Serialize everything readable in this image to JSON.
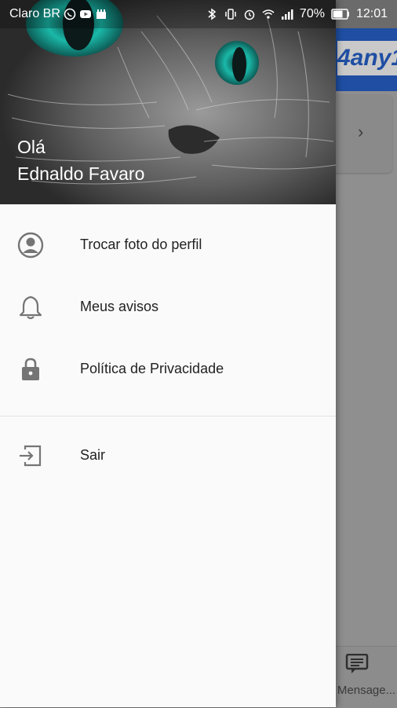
{
  "status_bar": {
    "carrier": "Claro BR",
    "battery": "70%",
    "time": "12:01"
  },
  "background_app": {
    "logo_text": "4any1",
    "bottom_tab_label": "Mensage..."
  },
  "drawer": {
    "greeting": "Olá",
    "user_name": "Ednaldo Favaro",
    "menu": [
      {
        "label": "Trocar foto do perfil",
        "icon": "profile-icon"
      },
      {
        "label": "Meus avisos",
        "icon": "bell-icon"
      },
      {
        "label": "Política de Privacidade",
        "icon": "lock-icon"
      },
      {
        "label": "Sair",
        "icon": "logout-icon"
      }
    ]
  }
}
